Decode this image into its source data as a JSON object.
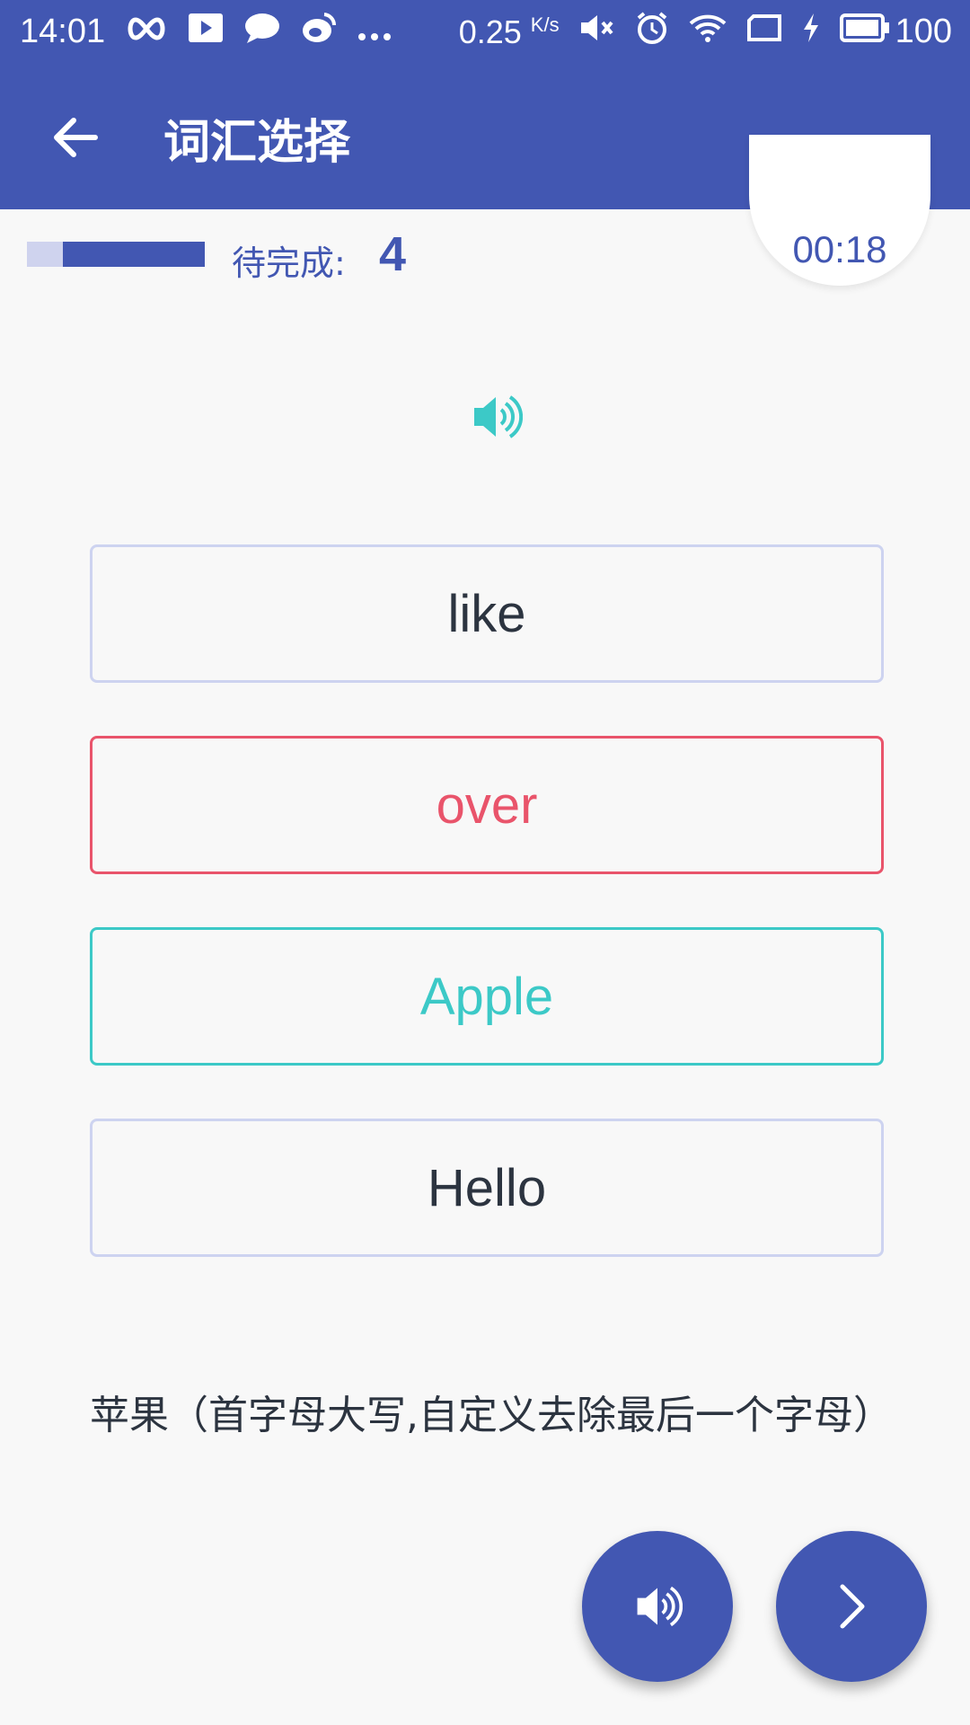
{
  "status_bar": {
    "time": "14:01",
    "net_speed": "0.25",
    "net_unit": "K/s",
    "battery": "100",
    "left_icons": [
      "infinity-icon",
      "play-icon",
      "chat-icon",
      "weibo-icon",
      "more-dots-icon"
    ],
    "right_icons": [
      "mute-icon",
      "alarm-icon",
      "wifi-icon",
      "screen-rotate-icon",
      "charging-icon",
      "battery-icon"
    ]
  },
  "app_bar": {
    "title": "词汇选择",
    "back_icon": "arrow-back-icon",
    "color": "#4257b2"
  },
  "progress": {
    "label": "待完成:",
    "remaining": "4",
    "fraction_complete": 0.8
  },
  "timer": {
    "value": "00:18"
  },
  "options": [
    {
      "text": "like",
      "state": "normal"
    },
    {
      "text": "over",
      "state": "wrong"
    },
    {
      "text": "Apple",
      "state": "correct"
    },
    {
      "text": "Hello",
      "state": "normal"
    }
  ],
  "hint": "苹果（首字母大写,自定义去除最后一个字母）",
  "colors": {
    "primary": "#4257b2",
    "correct": "#3cc9c7",
    "wrong": "#e9546b",
    "neutral_border": "#cdd3f0"
  },
  "fabs": {
    "speak_icon": "speaker-icon",
    "next_icon": "chevron-right-icon"
  }
}
